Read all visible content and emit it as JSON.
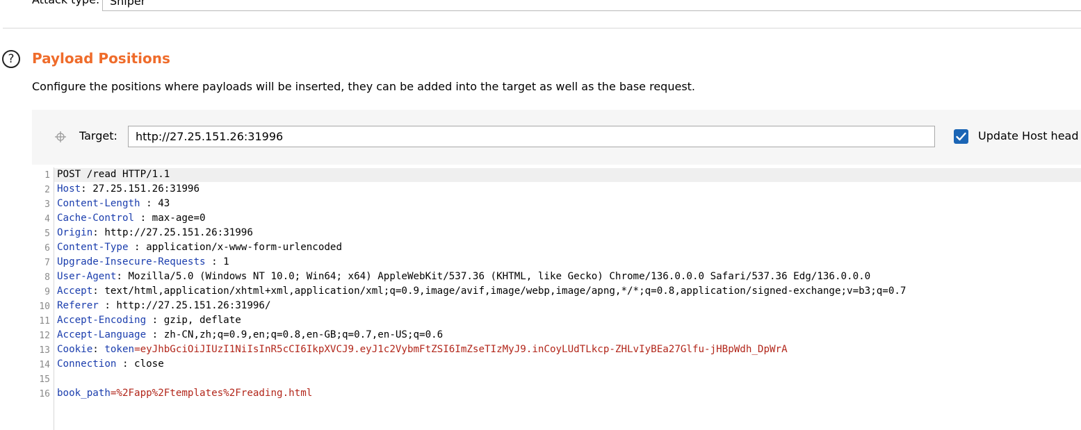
{
  "attack": {
    "label": "Attack type:",
    "value": "Sniper"
  },
  "section": {
    "help_icon": "question-circle-icon",
    "title": "Payload Positions",
    "description": "Configure the positions where payloads will be inserted, they can be added into the target as well as the base request."
  },
  "target": {
    "label": "Target:",
    "value": "http://27.25.151.26:31996",
    "move_icon": "crosshair-move-icon",
    "update_host_label": "Update Host head",
    "update_host_checked": true
  },
  "colors": {
    "title": "#ef6c2b",
    "header_name": "#1a3dad",
    "payload": "#b2261a",
    "checkbox": "#1b65b5"
  },
  "request": {
    "line_numbers": [
      "1",
      "2",
      "3",
      "4",
      "5",
      "6",
      "7",
      "8",
      "9",
      "10",
      "11",
      "12",
      "13",
      "14",
      "15",
      "16"
    ],
    "lines": [
      {
        "text": "POST /read HTTP/1.1"
      },
      {
        "name": "Host",
        "sep": ": ",
        "value": "27.25.151.26:31996"
      },
      {
        "name": "Content-Length",
        "sep": " : ",
        "value": "43"
      },
      {
        "name": "Cache-Control",
        "sep": " : ",
        "value": "max-age=0"
      },
      {
        "name": "Origin",
        "sep": ": ",
        "value": "http://27.25.151.26:31996"
      },
      {
        "name": "Content-Type",
        "sep": " : ",
        "value": "application/x-www-form-urlencoded"
      },
      {
        "name": "Upgrade-Insecure-Requests",
        "sep": " : ",
        "value": "1"
      },
      {
        "name": "User-Agent",
        "sep": ": ",
        "value": "Mozilla/5.0 (Windows NT 10.0; Win64; x64) AppleWebKit/537.36 (KHTML, like Gecko) Chrome/136.0.0.0 Safari/537.36 Edg/136.0.0.0"
      },
      {
        "name": "Accept",
        "sep": ": ",
        "value": "text/html,application/xhtml+xml,application/xml;q=0.9,image/avif,image/webp,image/apng,*/*;q=0.8,application/signed-exchange;v=b3;q=0.7"
      },
      {
        "name": "Referer",
        "sep": " : ",
        "value": "http://27.25.151.26:31996/"
      },
      {
        "name": "Accept-Encoding",
        "sep": " : ",
        "value": "gzip, deflate"
      },
      {
        "name": "Accept-Language",
        "sep": " : ",
        "value": "zh-CN,zh;q=0.9,en;q=0.8,en-GB;q=0.7,en-US;q=0.6"
      },
      {
        "name": "Cookie",
        "sep": ": ",
        "cookie_name": "token",
        "cookie_value": "=eyJhbGciOiJIUzI1NiIsInR5cCI6IkpXVCJ9.eyJ1c2VybmFtZSI6ImZseTIzMyJ9.inCoyLUdTLkcp-ZHLvIyBEa27Glfu-jHBpWdh_DpWrA"
      },
      {
        "name": "Connection",
        "sep": " : ",
        "value": "close"
      },
      {
        "text": ""
      },
      {
        "param_name": "book_path",
        "param_value": "=%2Fapp%2Ftemplates%2Freading.html"
      }
    ]
  }
}
